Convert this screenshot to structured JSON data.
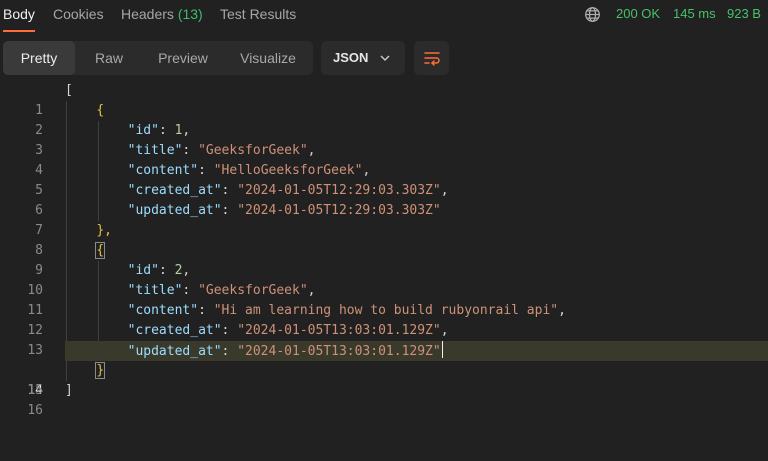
{
  "response_tabs": {
    "body": "Body",
    "cookies": "Cookies",
    "headers": "Headers",
    "headers_count": "(13)",
    "test_results": "Test Results"
  },
  "status": {
    "code": "200 OK",
    "time": "145 ms",
    "size": "923 B"
  },
  "view_modes": {
    "pretty": "Pretty",
    "raw": "Raw",
    "preview": "Preview",
    "visualize": "Visualize",
    "active": "Pretty"
  },
  "format_select": {
    "value": "JSON"
  },
  "icons": {
    "globe": "globe-icon",
    "chevron": "chevron-down-icon",
    "wrap": "wrap-lines-icon"
  },
  "colors": {
    "accent": "#ff6c37",
    "status_ok": "#49c06a",
    "key": "#9cdcfe",
    "string": "#ce9178",
    "number": "#b5cea8"
  },
  "editor": {
    "current_line": 14,
    "line_numbers": [
      "1",
      "2",
      "3",
      "4",
      "5",
      "6",
      "7",
      "8",
      "9",
      "10",
      "11",
      "12",
      "13",
      "14",
      "15",
      "16"
    ],
    "punct": {
      "array_open": "[",
      "array_close": "]",
      "obj_open": "{",
      "obj_close": "}",
      "obj_close_comma": "},",
      "colon": ": ",
      "comma": ","
    },
    "records": [
      {
        "id_key": "\"id\"",
        "id_val": "1",
        "title_key": "\"title\"",
        "title_val": "\"GeeksforGeek\"",
        "content_key": "\"content\"",
        "content_val": "\"HelloGeeksforGeek\"",
        "created_key": "\"created_at\"",
        "created_val": "\"2024-01-05T12:29:03.303Z\"",
        "updated_key": "\"updated_at\"",
        "updated_val": "\"2024-01-05T12:29:03.303Z\""
      },
      {
        "id_key": "\"id\"",
        "id_val": "2",
        "title_key": "\"title\"",
        "title_val": "\"GeeksforGeek\"",
        "content_key": "\"content\"",
        "content_val": "\"Hi am learning how to build rubyonrail api\"",
        "created_key": "\"created_at\"",
        "created_val": "\"2024-01-05T13:03:01.129Z\"",
        "updated_key": "\"updated_at\"",
        "updated_val": "\"2024-01-05T13:03:01.129Z\""
      }
    ]
  }
}
